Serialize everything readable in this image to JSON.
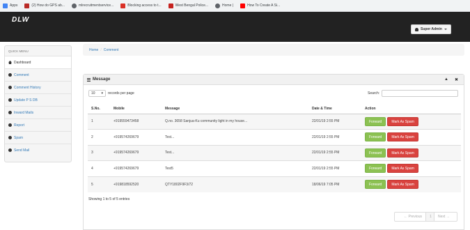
{
  "bookmarks": [
    {
      "label": "Apps",
      "icon": "apps-grid-icon",
      "color": "#4285f4"
    },
    {
      "label": "(2) How do GPS ab...",
      "icon": "quora-icon",
      "color": "#b92b27"
    },
    {
      "label": "mlrecruitmentservice...",
      "icon": "globe-icon",
      "color": "#5f6368"
    },
    {
      "label": "Blocking access to t...",
      "icon": "page-icon",
      "color": "#d93025"
    },
    {
      "label": "West Bengal Police...",
      "icon": "police-badge-icon",
      "color": "#c5221f"
    },
    {
      "label": "Home |",
      "icon": "globe-icon",
      "color": "#5f6368"
    },
    {
      "label": "How To Create A Si...",
      "icon": "youtube-icon",
      "color": "#ff0000"
    }
  ],
  "navbar": {
    "brand": "DLW",
    "user_button": "Super Admin"
  },
  "sidebar": {
    "heading": "QUICK MENU",
    "items": [
      {
        "label": "Dashboard",
        "icon": "home-icon",
        "active": true
      },
      {
        "label": "Comment",
        "icon": "circle-plus-icon"
      },
      {
        "label": "Comment History",
        "icon": "circle-plus-icon"
      },
      {
        "label": "Update P S DB",
        "icon": "circle-plus-icon"
      },
      {
        "label": "Inward Mails",
        "icon": "circle-plus-icon"
      },
      {
        "label": "Report",
        "icon": "circle-plus-icon"
      },
      {
        "label": "Spam",
        "icon": "circle-plus-icon"
      },
      {
        "label": "Send Mail",
        "icon": "circle-plus-icon"
      }
    ]
  },
  "breadcrumb": {
    "home": "Home",
    "separator": "/",
    "current": "Comment"
  },
  "panel": {
    "title": "Message",
    "length_value": "10",
    "length_suffix": "records per page",
    "search_label": "Search:",
    "search_value": "",
    "columns": [
      "S.No.",
      "Mobile",
      "Message",
      "Date & Time",
      "Action"
    ],
    "rows": [
      {
        "sno": "1",
        "mobile": "+919559473458",
        "message": "Q.no. 3658 Sanjua-Ku community light in my house...",
        "datetime": "22/01/19 2:55 PM"
      },
      {
        "sno": "2",
        "mobile": "+919574269679",
        "message": "Test...",
        "datetime": "22/01/19 2:55 PM"
      },
      {
        "sno": "3",
        "mobile": "+919574269679",
        "message": "Test...",
        "datetime": "22/01/19 2:55 PM"
      },
      {
        "sno": "4",
        "mobile": "+919574269679",
        "message": "Test5",
        "datetime": "22/01/19 2:55 PM"
      },
      {
        "sno": "5",
        "mobile": "+919818592520",
        "message": "QTY1802F9F3/72",
        "datetime": "18/06/19 7:05 PM"
      }
    ],
    "forward_label": "Forward",
    "spam_label": "Mark As Spam",
    "info": "Showing 1 to 5 of 5 entries",
    "pager": {
      "previous": "← Previous",
      "current": "1",
      "next": "Next →"
    }
  },
  "colors": {
    "navbar": "#222222",
    "forward": "#8cc152",
    "spam": "#d9433f",
    "link": "#337ab7"
  }
}
